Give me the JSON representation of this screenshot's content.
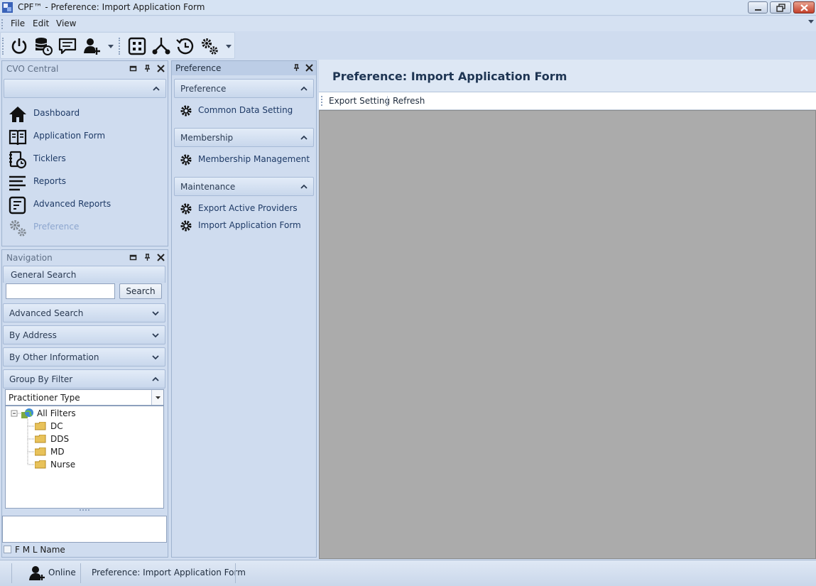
{
  "window": {
    "title": "CPF™  -  Preference: Import Application Form"
  },
  "menu": [
    {
      "label": "File"
    },
    {
      "label": "Edit"
    },
    {
      "label": "View"
    }
  ],
  "toolbar": {
    "buttons": [
      "power-icon",
      "database-clock-icon",
      "chat-icon",
      "add-user-icon",
      "grid-icon",
      "fork-icon",
      "history-icon",
      "settings-gears-icon"
    ]
  },
  "cvo_central": {
    "title": "CVO Central",
    "items": [
      {
        "label": "Dashboard",
        "icon": "home-icon"
      },
      {
        "label": "Application Form",
        "icon": "book-icon"
      },
      {
        "label": "Ticklers",
        "icon": "tickler-clock-icon"
      },
      {
        "label": "Reports",
        "icon": "reports-lines-icon"
      },
      {
        "label": "Advanced Reports",
        "icon": "advanced-report-icon"
      },
      {
        "label": "Preference",
        "icon": "gears-icon",
        "disabled": true
      }
    ]
  },
  "navigation": {
    "title": "Navigation",
    "general_search": {
      "label": "General Search",
      "value": "",
      "button": "Search"
    },
    "groups": [
      {
        "label": "Advanced Search"
      },
      {
        "label": "By Address"
      },
      {
        "label": "By Other Information"
      }
    ],
    "group_by_filter": {
      "label": "Group By Filter",
      "selected": "Practitioner Type",
      "tree": {
        "root": "All Filters",
        "children": [
          "DC",
          "DDS",
          "MD",
          "Nurse"
        ]
      }
    },
    "checkbox_label": "F M L Name"
  },
  "preference_panel": {
    "title": "Preference",
    "sections": [
      {
        "label": "Preference",
        "items": [
          "Common Data Setting"
        ]
      },
      {
        "label": "Membership",
        "items": [
          "Membership Management"
        ]
      },
      {
        "label": "Maintenance",
        "items": [
          "Export Active Providers",
          "Import Application Form"
        ]
      }
    ]
  },
  "main": {
    "title": "Preference: Import Application Form",
    "toolbar": {
      "export": "Export Setting",
      "refresh": "Refresh"
    }
  },
  "status": {
    "online": "Online",
    "page": "Preference: Import Application Form"
  }
}
